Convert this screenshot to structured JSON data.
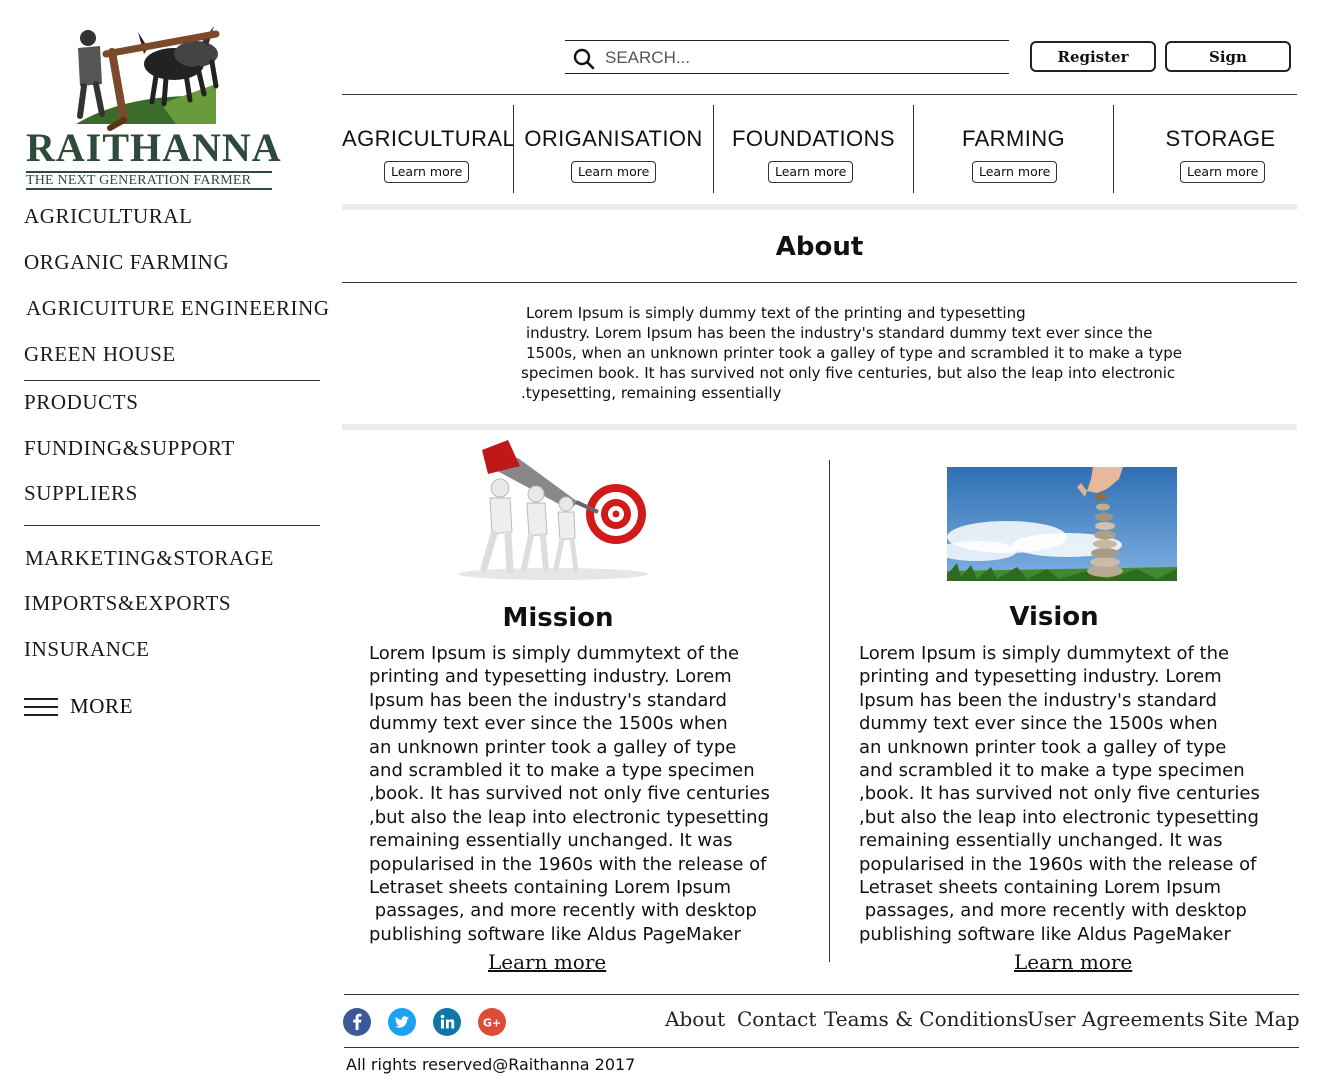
{
  "logo": {
    "brand": "RAITHANNA",
    "tagline": "THE NEXT GENERATION FARMER"
  },
  "sidebar": {
    "items": [
      {
        "label": "AGRICULTURAL"
      },
      {
        "label": "ORGANIC FARMING"
      },
      {
        "label": "AGRICUITURE ENGINEERING"
      },
      {
        "label": "GREEN HOUSE"
      },
      {
        "label": "PRODUCTS"
      },
      {
        "label": "FUNDING&SUPPORT"
      },
      {
        "label": "SUPPLIERS"
      },
      {
        "label": "MARKETING&STORAGE"
      },
      {
        "label": "IMPORTS&EXPORTS"
      },
      {
        "label": "INSURANCE"
      }
    ],
    "more_label": "MORE"
  },
  "header": {
    "search_placeholder": "SEARCH...",
    "register_label": "Register",
    "sign_label": "Sign"
  },
  "categories": [
    {
      "title": "AGRICULTURAL",
      "button": "Learn more"
    },
    {
      "title": "ORIGANISATION",
      "button": "Learn more"
    },
    {
      "title": "FOUNDATIONS",
      "button": "Learn more"
    },
    {
      "title": "FARMING",
      "button": "Learn more"
    },
    {
      "title": "STORAGE",
      "button": "Learn more"
    }
  ],
  "about": {
    "title": "About",
    "lines": [
      "Lorem Ipsum is simply dummy text of the printing and typesetting",
      "industry. Lorem Ipsum has been the industry's standard dummy text ever since the",
      "1500s, when an unknown printer took a galley of type and scrambled it to make a type",
      "specimen book. It has survived not only five centuries, but also the leap into electronic",
      ".typesetting, remaining essentially"
    ]
  },
  "mission": {
    "title": "Mission",
    "lines": [
      "Lorem Ipsum is simply dummytext of the",
      "printing and typesetting industry. Lorem",
      "Ipsum has been the industry's standard",
      "dummy text ever since the 1500s when",
      "an unknown printer took a galley of type",
      "and scrambled it to make a type specimen",
      ",book. It has survived not only five centuries",
      ",but also the leap into electronic typesetting",
      "remaining essentially unchanged. It was",
      "popularised in the 1960s with the release of",
      "Letraset sheets containing Lorem Ipsum",
      " passages, and more recently with desktop",
      "publishing software like Aldus PageMaker"
    ],
    "link": "Learn more"
  },
  "vision": {
    "title": "Vision",
    "lines": [
      "Lorem Ipsum is simply dummytext of the",
      "printing and typesetting industry. Lorem",
      "Ipsum has been the industry's standard",
      "dummy text ever since the 1500s when",
      "an unknown printer took a galley of type",
      "and scrambled it to make a type specimen",
      ",book. It has survived not only five centuries",
      ",but also the leap into electronic typesetting",
      "remaining essentially unchanged. It was",
      "popularised in the 1960s with the release of",
      "Letraset sheets containing Lorem Ipsum",
      " passages, and more recently with desktop",
      "publishing software like Aldus PageMaker"
    ],
    "link": "Learn more"
  },
  "footer": {
    "social": [
      {
        "icon": "facebook-icon",
        "color": "#3b5998"
      },
      {
        "icon": "twitter-icon",
        "color": "#1da1f2"
      },
      {
        "icon": "linkedin-icon",
        "color": "#0e76a8"
      },
      {
        "icon": "google-plus-icon",
        "color": "#dd4b39"
      }
    ],
    "links": [
      {
        "label": "About"
      },
      {
        "label": "Contact"
      },
      {
        "label": "Teams & Conditions"
      },
      {
        "label": "User Agreements"
      },
      {
        "label": "Site Map"
      }
    ],
    "copyright": "All rights reserved@Raithanna 2017"
  },
  "colors": {
    "brand_green": "#2e4a3b",
    "text": "#111111",
    "band_gray": "#ececec"
  }
}
